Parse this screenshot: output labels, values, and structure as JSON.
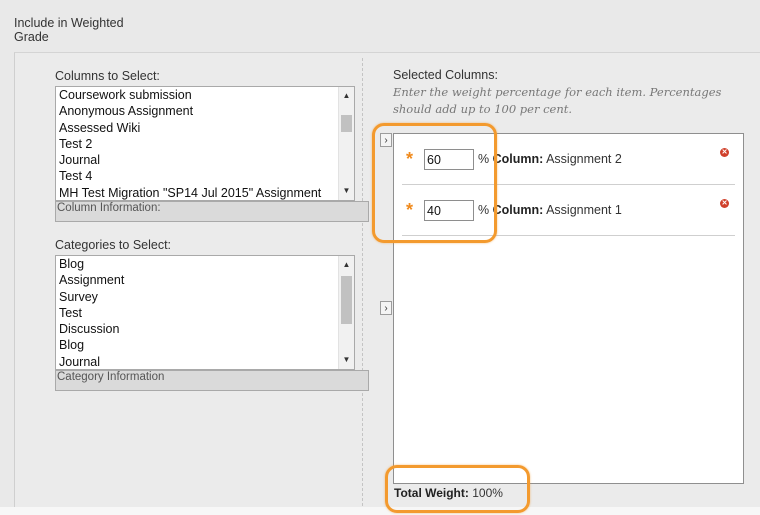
{
  "section_title": "Include in Weighted Grade",
  "columns_label": "Columns to Select:",
  "columns_items": [
    "Coursework submission",
    "Anonymous Assignment",
    "Assessed Wiki",
    "Test 2",
    "Journal",
    "Test 4",
    "MH Test Migration \"SP14 Jul 2015\" Assignment"
  ],
  "columns_info": "Column Information:",
  "categories_label": "Categories to Select:",
  "categories_items": [
    "Blog",
    "Assignment",
    "Survey",
    "Test",
    "Discussion",
    "Blog",
    "Journal"
  ],
  "categories_info": "Category Information",
  "selected_title": "Selected Columns:",
  "selected_help": "Enter the weight percentage for each item. Percentages should add up to 100 per cent.",
  "selected_rows": [
    {
      "percent": "60",
      "pct_sign": "%",
      "column_label": "Column:",
      "column_name": "Assignment 2"
    },
    {
      "percent": "40",
      "pct_sign": "%",
      "column_label": "Column:",
      "column_name": "Assignment 1"
    }
  ],
  "total_label": "Total Weight:",
  "total_value": "100%",
  "icons": {
    "move_right": "chevron-right-icon",
    "remove": "remove-icon",
    "required": "required-asterisk-icon",
    "scroll_up": "scroll-up-icon",
    "scroll_down": "scroll-down-icon"
  },
  "colors": {
    "highlight": "#f39a2e",
    "required_star": "#f08a1c",
    "remove_icon": "#d0402b"
  }
}
